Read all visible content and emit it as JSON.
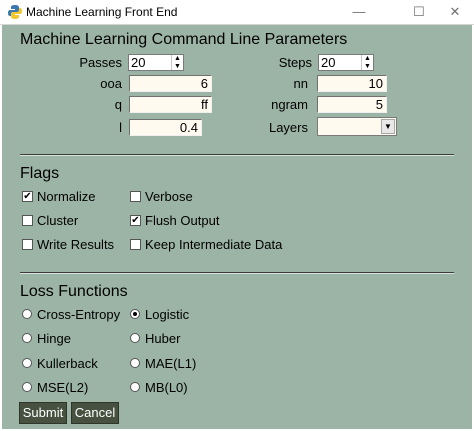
{
  "window": {
    "title": "Machine Learning Front End",
    "minimize": "—",
    "maximize": "☐",
    "close": "✕"
  },
  "parameters": {
    "heading": "Machine Learning Command Line Parameters",
    "passes": {
      "label": "Passes",
      "value": "20"
    },
    "steps": {
      "label": "Steps",
      "value": "20"
    },
    "ooa": {
      "label": "ooa",
      "value": "6"
    },
    "nn": {
      "label": "nn",
      "value": "10"
    },
    "q": {
      "label": "q",
      "value": "ff"
    },
    "ngram": {
      "label": "ngram",
      "value": "5"
    },
    "l": {
      "label": "l",
      "value": "0.4"
    },
    "layers": {
      "label": "Layers",
      "value": ""
    }
  },
  "flags": {
    "heading": "Flags",
    "items": [
      {
        "label": "Normalize",
        "checked": true
      },
      {
        "label": "Verbose",
        "checked": false
      },
      {
        "label": "Cluster",
        "checked": false
      },
      {
        "label": "Flush Output",
        "checked": true
      },
      {
        "label": "Write Results",
        "checked": false
      },
      {
        "label": "Keep Intermediate Data",
        "checked": false
      }
    ]
  },
  "loss": {
    "heading": "Loss Functions",
    "selected": "Logistic",
    "items": [
      {
        "label": "Cross-Entropy"
      },
      {
        "label": "Logistic"
      },
      {
        "label": "Hinge"
      },
      {
        "label": "Huber"
      },
      {
        "label": "Kullerback"
      },
      {
        "label": "MAE(L1)"
      },
      {
        "label": "MSE(L2)"
      },
      {
        "label": "MB(L0)"
      }
    ]
  },
  "actions": {
    "submit": "Submit",
    "cancel": "Cancel"
  },
  "colors": {
    "background": "#9cb4a6",
    "button": "#46523f",
    "entry": "#fffaf0"
  }
}
